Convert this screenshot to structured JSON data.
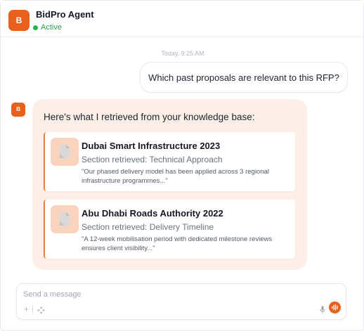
{
  "header": {
    "avatar_letter": "B",
    "agent_name": "BidPro Agent",
    "status": "Active"
  },
  "chat": {
    "timestamp": "Today, 9:25 AM",
    "user_message": "Which past proposals are relevant to this RFP?",
    "bot_avatar_letter": "B",
    "bot_intro": "Here's what I retrieved from your knowledge base:",
    "results": [
      {
        "title": "Dubai Smart Infrastructure 2023",
        "section": "Section retrieved: Technical Approach",
        "quote": "\"Our phased delivery model has been applied across 3 regional infrastructure programmes...\""
      },
      {
        "title": "Abu Dhabi Roads Authority 2022",
        "section": "Section retrieved: Delivery Timeline",
        "quote": "\"A 12-week mobilisation period with dedicated milestone reviews ensures client visibility...\""
      }
    ]
  },
  "composer": {
    "placeholder": "Send a message",
    "value": ""
  },
  "icons": {
    "attach": "plus-icon",
    "tools": "sparkle-icon",
    "mic": "microphone-icon",
    "voice": "voice-waveform-icon",
    "document": "document-icon"
  },
  "colors": {
    "accent": "#e8611c",
    "bot_bubble": "#fcefe7",
    "status_green": "#22b14c"
  }
}
